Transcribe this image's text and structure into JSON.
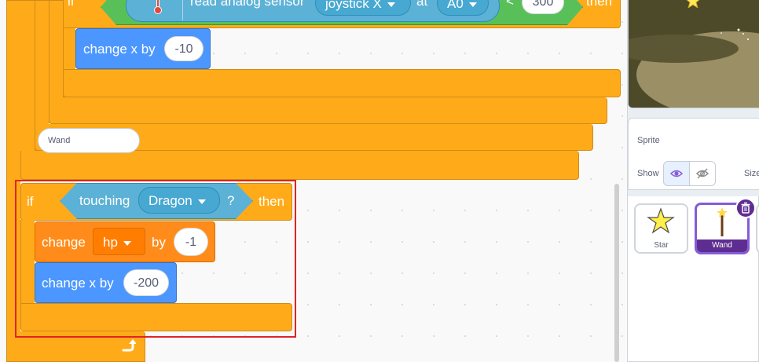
{
  "blocks": {
    "sensor_label": "read analog sensor",
    "sensor_dropdown": "joystick X",
    "at_label": "at",
    "pin_dropdown": "A0",
    "lt_symbol": "<",
    "threshold": "300",
    "then_top": "then",
    "if_top": "if",
    "change_x_label": "change x by",
    "change_x_value": "-10",
    "if_label": "if",
    "touching_label": "touching",
    "touching_target": "Dragon",
    "question": "?",
    "then_label": "then",
    "change_label": "change",
    "var_dropdown": "hp",
    "by_label": "by",
    "var_value": "-1",
    "change_x2_label": "change x by",
    "change_x2_value": "-200"
  },
  "sprite_info": {
    "sprite_label": "Sprite",
    "sprite_name": "Wand",
    "show_label": "Show",
    "size_label": "Size"
  },
  "sprites": [
    {
      "name": "Star",
      "selected": false
    },
    {
      "name": "Wand",
      "selected": true
    }
  ],
  "colors": {
    "control": "#ffab19",
    "motion": "#4c97ff",
    "variables": "#ff8c1a",
    "operators": "#59c059",
    "sensing": "#5cb1d6",
    "highlight": "#e02424",
    "selected": "#855cd6"
  }
}
